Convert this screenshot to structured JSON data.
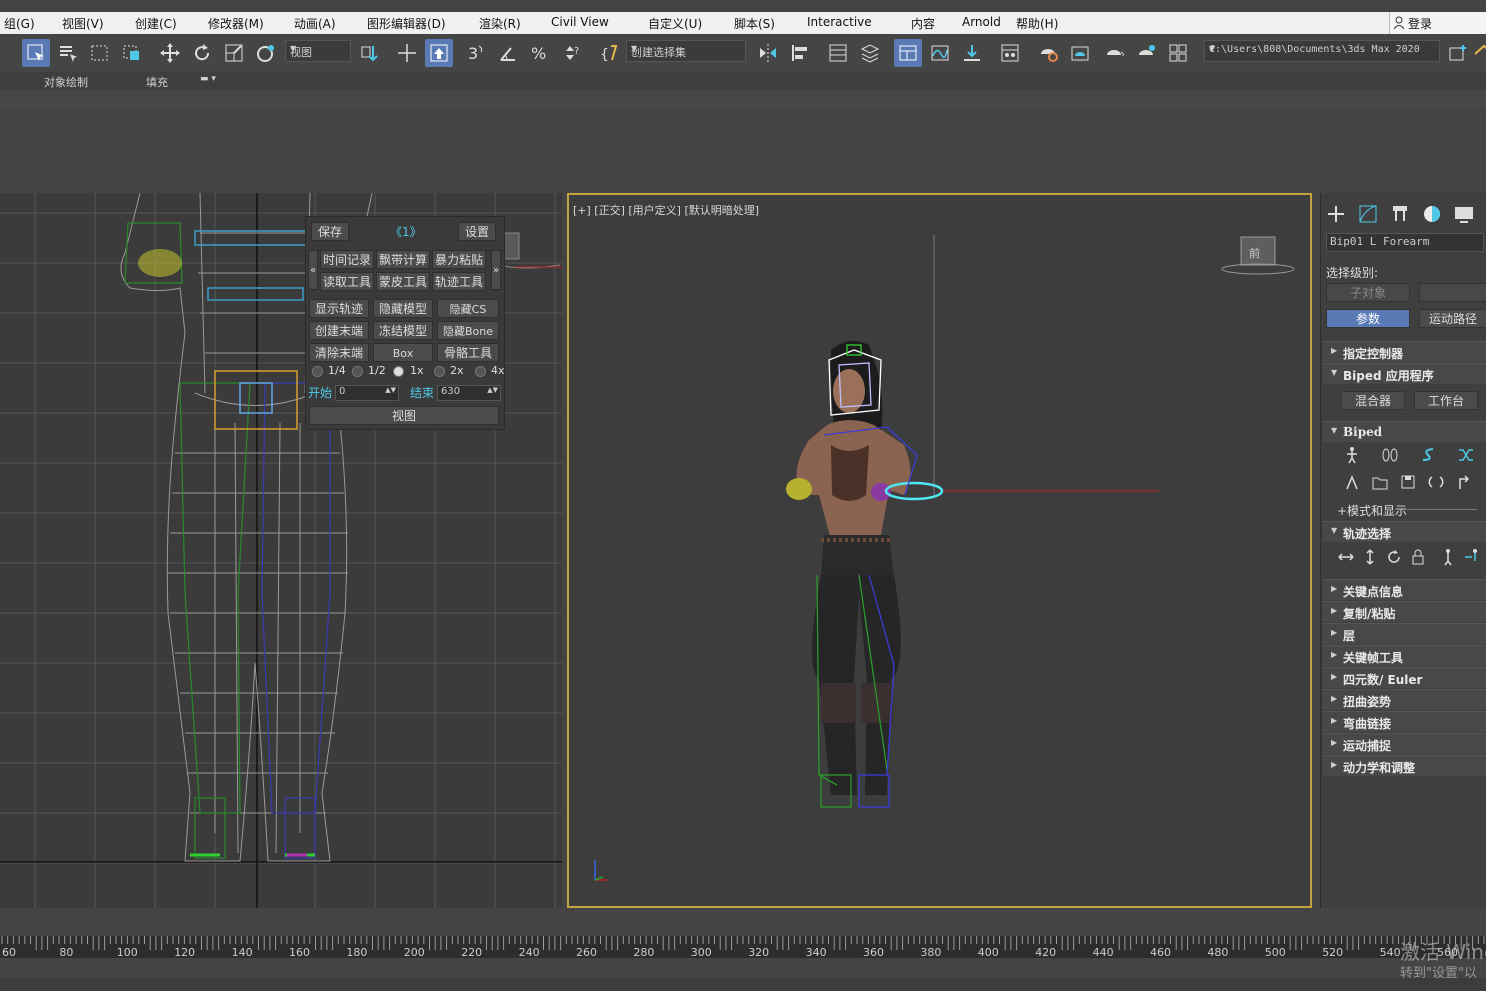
{
  "menu": [
    "组(G)",
    "视图(V)",
    "创建(C)",
    "修改器(M)",
    "动画(A)",
    "图形编辑器(D)",
    "渲染(R)",
    "Civil View",
    "自定义(U)",
    "脚本(S)",
    "Interactive",
    "内容",
    "Arnold",
    "帮助(H)"
  ],
  "login_label": "登录",
  "toolbar": {
    "view_dropdown": "视图",
    "selection_set_dropdown": "创建选择集",
    "project_path": "C:\\Users\\808\\Documents\\3ds Max 2020"
  },
  "ribbon": {
    "object_paint": "对象绘制",
    "fill": "填充"
  },
  "viewport": {
    "label": "[+] [正交] [用户定义] [默认明暗处理]",
    "cube_label": "前"
  },
  "panel": {
    "save": "保存",
    "page": "《1》",
    "settings": "设置",
    "row1": [
      "时间记录",
      "飘带计算",
      "暴力粘贴"
    ],
    "row2": [
      "读取工具",
      "蒙皮工具",
      "轨迹工具"
    ],
    "row3": [
      "显示轨迹",
      "隐藏模型",
      "隐藏CS"
    ],
    "row4": [
      "创建末端",
      "冻结模型",
      "隐藏Bone"
    ],
    "row5": [
      "清除末端",
      "Box",
      "骨骼工具"
    ],
    "speeds": [
      "1/4",
      "1/2",
      "1x",
      "2x",
      "4x"
    ],
    "start_label": "开始",
    "start_value": "0",
    "end_label": "结束",
    "end_value": "630",
    "view_button": "视图"
  },
  "command_panel": {
    "object_name": "Bip01 L Forearm",
    "selection_level": "选择级别:",
    "subobject": "子对象",
    "params": "参数",
    "motion_path": "运动路径",
    "rollouts": {
      "assign_controller": "指定控制器",
      "biped_apps": "Biped 应用程序",
      "mixer": "混合器",
      "workbench": "工作台",
      "biped": "Biped",
      "modes_display": "+模式和显示",
      "track_selection": "轨迹选择",
      "key_info": "关键点信息",
      "copy_paste": "复制/粘贴",
      "layers": "层",
      "keyframe_tools": "关键帧工具",
      "quaternion": "四元数/ Euler",
      "twist_poses": "扭曲姿势",
      "bend_links": "弯曲链接",
      "motion_capture": "运动捕捉",
      "dynamics": "动力学和调整"
    }
  },
  "timeline": {
    "labels": [
      "60",
      "80",
      "100",
      "120",
      "140",
      "160",
      "180",
      "200",
      "220",
      "240",
      "260",
      "280",
      "300",
      "320",
      "340",
      "360",
      "380",
      "400",
      "420",
      "440",
      "460",
      "480",
      "500",
      "520",
      "540",
      "560"
    ]
  },
  "watermark": {
    "line1": "激活 Wind",
    "line2": "转到\"设置\"以"
  },
  "colors": {
    "accent": "#5a7ab5",
    "viewport_border": "#c3a33e",
    "cyan_text": "#4fc8e8"
  }
}
